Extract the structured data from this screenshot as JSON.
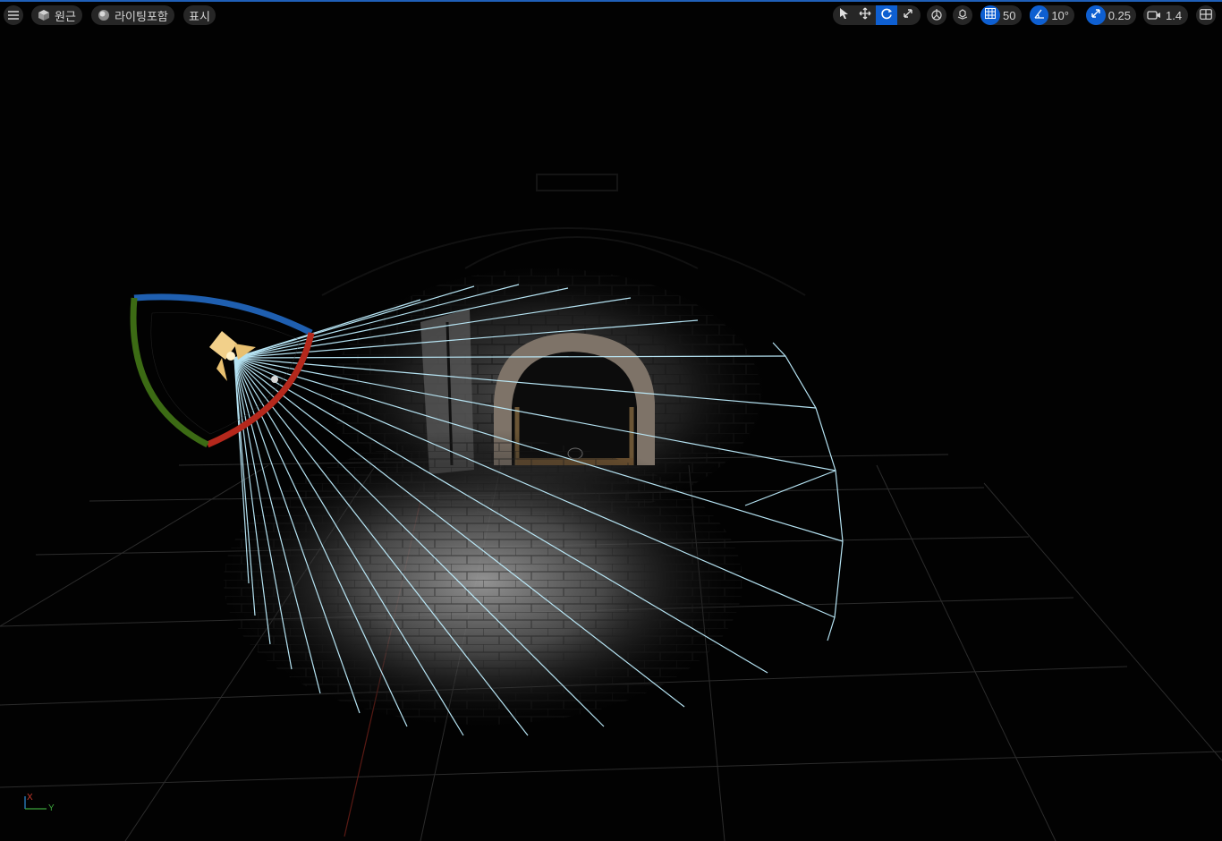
{
  "toolbar": {
    "menu_icon": "hamburger-menu-icon",
    "perspective_label": "원근",
    "lighting_label": "라이팅포함",
    "show_label": "표시",
    "transform_tools": [
      "select-icon",
      "translate-icon",
      "rotate-icon",
      "scale-icon"
    ],
    "active_tool": "rotate",
    "grid_snap_value": "50",
    "rotation_snap_value": "10°",
    "scale_snap_value": "0.25",
    "camera_speed_value": "1.4"
  },
  "colors": {
    "accent": "#0e5fd1",
    "light_cone_lines": "#bfefff",
    "gizmo_x": "#b5281c",
    "gizmo_y": "#3c6b14",
    "gizmo_z": "#1f5fb0",
    "spotlight_icon": "#f2d08a"
  },
  "axis_gizmo": {
    "x_label": "X",
    "y_label": "Y"
  }
}
